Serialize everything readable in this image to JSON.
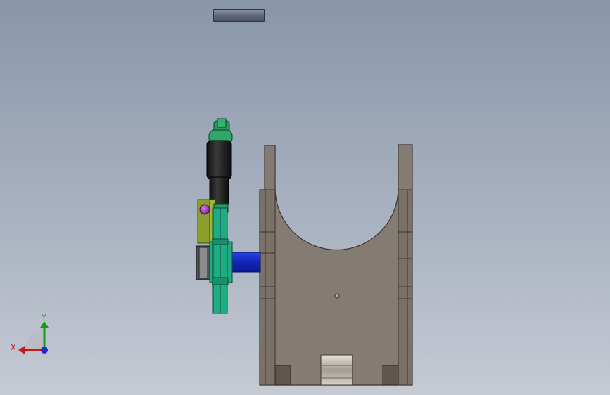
{
  "triad": {
    "x_label": "X",
    "y_label": "Y",
    "x_color": "#c81818",
    "y_color": "#1a9a1a",
    "z_color": "#1a2ad8"
  },
  "colors": {
    "housing": "#847b73",
    "housing_dark": "#4e4741",
    "cylinder": "#1f1f1f",
    "fitting": "#2b9a63",
    "wheel": "#1eac82",
    "bracket": "#8aa02a",
    "shaft": "#1a2fc8",
    "sensor": "#b23ad0"
  },
  "icons": {
    "toolbar": "view-toolbar-icon",
    "triad": "reference-triad-icon"
  }
}
